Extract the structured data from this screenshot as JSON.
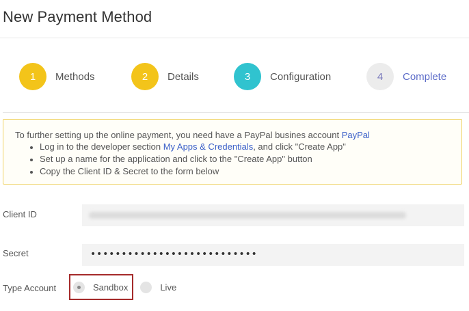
{
  "page": {
    "title": "New Payment Method"
  },
  "steps": [
    {
      "number": "1",
      "label": "Methods",
      "color": "#f3c41a"
    },
    {
      "number": "2",
      "label": "Details",
      "color": "#f3c41a"
    },
    {
      "number": "3",
      "label": "Configuration",
      "color": "#30c3cf"
    },
    {
      "number": "4",
      "label": "Complete",
      "color": "#ececec"
    }
  ],
  "notice": {
    "intro": "To further setting up the online payment, you need have a PayPal busines account ",
    "intro_link": "PayPal",
    "item1_prefix": "Log in to the developer section ",
    "item1_link": "My Apps & Credentials",
    "item1_suffix": ", and click \"Create App\"",
    "item2": "Set up a name for the application and click to the \"Create App\" button",
    "item3": "Copy the Client ID & Secret to the form below"
  },
  "form": {
    "client_id_label": "Client ID",
    "secret_label": "Secret",
    "secret_value": "•••••••••••••••••••••••••••",
    "type_account_label": "Type Account",
    "options": [
      {
        "label": "Sandbox",
        "selected": true
      },
      {
        "label": "Live",
        "selected": false
      }
    ]
  },
  "colors": {
    "accent_yellow": "#f3c41a",
    "accent_teal": "#30c3cf",
    "link": "#3a5fc8",
    "highlight_border": "#a52b2b"
  }
}
